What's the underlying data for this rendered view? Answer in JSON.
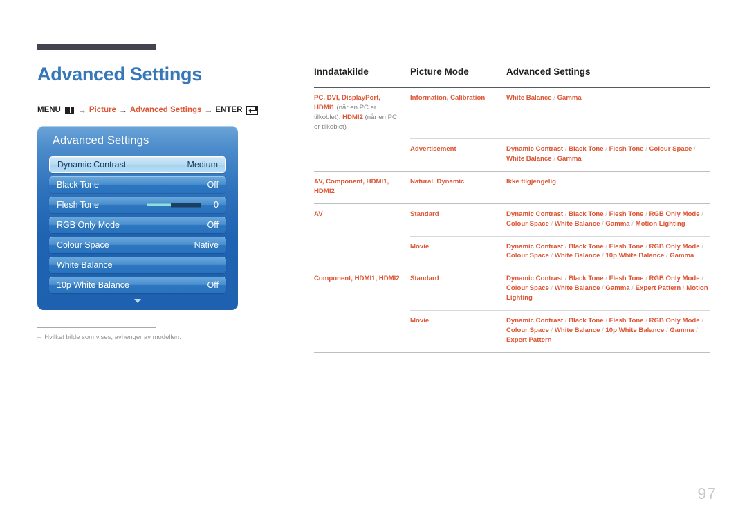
{
  "page": {
    "title": "Advanced Settings",
    "number": "97"
  },
  "menu_path": {
    "menu_label": "MENU",
    "menu_icon": "menu-grid-icon",
    "arrow": "→",
    "step1": "Picture",
    "step2": "Advanced Settings",
    "enter_label": "ENTER",
    "enter_icon": "enter-return-icon"
  },
  "osd": {
    "title": "Advanced Settings",
    "scroll_icon": "chevron-down-icon",
    "items": [
      {
        "label": "Dynamic Contrast",
        "value": "Medium",
        "selected": true,
        "slider": false
      },
      {
        "label": "Black Tone",
        "value": "Off",
        "selected": false,
        "slider": false
      },
      {
        "label": "Flesh Tone",
        "value": "0",
        "selected": false,
        "slider": true
      },
      {
        "label": "RGB Only Mode",
        "value": "Off",
        "selected": false,
        "slider": false
      },
      {
        "label": "Colour Space",
        "value": "Native",
        "selected": false,
        "slider": false
      },
      {
        "label": "White Balance",
        "value": "",
        "selected": false,
        "slider": false
      },
      {
        "label": "10p White Balance",
        "value": "Off",
        "selected": false,
        "slider": false
      }
    ]
  },
  "footnote": {
    "dash": "–",
    "text": "Hvilket bilde som vises, avhenger av modellen."
  },
  "table": {
    "headers": [
      "Inndatakilde",
      "Picture Mode",
      "Advanced Settings"
    ],
    "rows": [
      {
        "separator": "full",
        "source": "PC, DVI, DisplayPort, HDMI1 (når en PC er tilkoblet), HDMI2 (når en PC er tilkoblet)",
        "source_parts": [
          {
            "t": "PC, DVI, DisplayPort, HDMI1",
            "muted": false
          },
          {
            "t": "(når en PC er tilkoblet),",
            "muted": true
          },
          {
            "t": "HDMI2",
            "muted": false
          },
          {
            "t": "(når en PC er tilkoblet)",
            "muted": true
          }
        ],
        "mode": "Information, Calibration",
        "settings": "White Balance / Gamma",
        "settings_na": false
      },
      {
        "separator": "inner",
        "source_parts": [],
        "mode": "Advertisement",
        "settings": "Dynamic Contrast / Black Tone / Flesh Tone / Colour Space / White Balance / Gamma",
        "settings_na": false
      },
      {
        "separator": "full",
        "source_parts": [
          {
            "t": "AV, Component, HDMI1,",
            "muted": false
          },
          {
            "t": "HDMI2",
            "muted": false
          }
        ],
        "mode": "Natural, Dynamic",
        "settings": "Ikke tilgjengelig",
        "settings_na": true
      },
      {
        "separator": "full",
        "source_parts": [
          {
            "t": "AV",
            "muted": false
          }
        ],
        "mode": "Standard",
        "settings": "Dynamic Contrast / Black Tone / Flesh Tone / RGB Only Mode / Colour Space / White Balance / Gamma / Motion Lighting",
        "settings_na": false
      },
      {
        "separator": "inner",
        "source_parts": [],
        "mode": "Movie",
        "settings": "Dynamic Contrast / Black Tone / Flesh Tone / RGB Only Mode / Colour Space / White Balance / 10p White Balance / Gamma",
        "settings_na": false
      },
      {
        "separator": "full",
        "source_parts": [
          {
            "t": "Component, HDMI1, HDMI2",
            "muted": false
          }
        ],
        "mode": "Standard",
        "settings": "Dynamic Contrast / Black Tone / Flesh Tone / RGB Only Mode / Colour Space / White Balance / Gamma / Expert Pattern / Motion Lighting",
        "settings_na": false
      },
      {
        "separator": "inner",
        "source_parts": [],
        "mode": "Movie",
        "settings": "Dynamic Contrast / Black Tone / Flesh Tone / RGB Only Mode / Colour Space / White Balance / 10p White Balance / Gamma / Expert Pattern",
        "settings_na": false
      }
    ],
    "bottom_separator": true
  },
  "colors": {
    "accent_orange": "#dd5533",
    "title_blue": "#3577b9",
    "rule_dark": "#46424f",
    "osd_blue": "#2a72bd"
  }
}
